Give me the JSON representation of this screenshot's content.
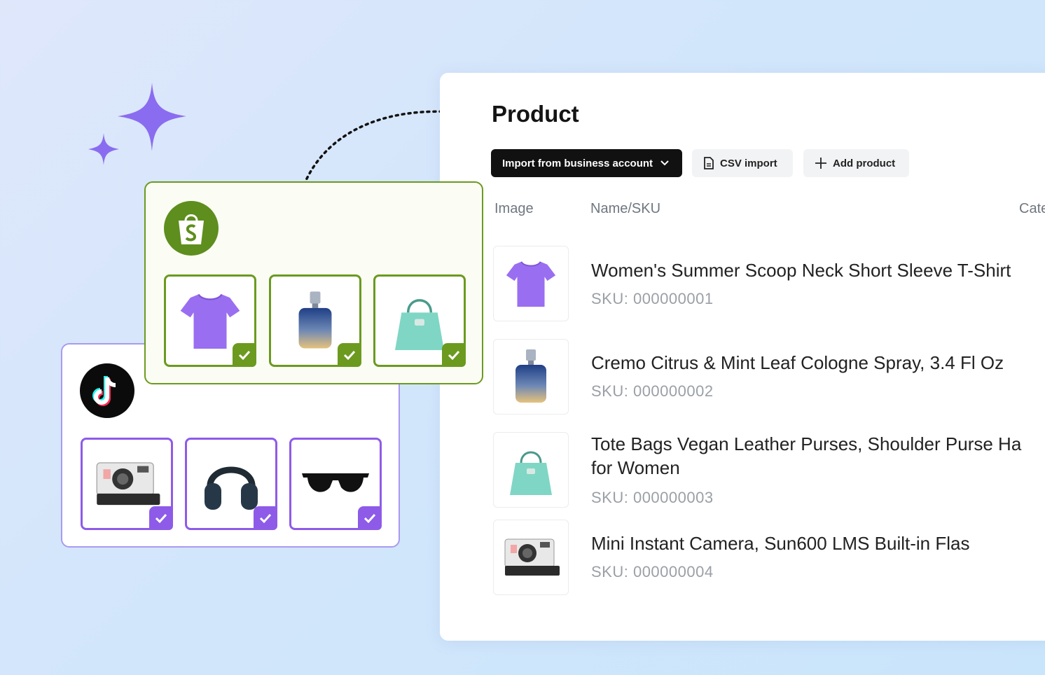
{
  "panel": {
    "title": "Product",
    "import_button": "Import from business account",
    "csv_button": "CSV import",
    "add_button": "Add product",
    "columns": [
      "Image",
      "Name/SKU",
      "Cate"
    ]
  },
  "products": [
    {
      "name": "Women's Summer Scoop Neck Short Sleeve T-Shirt",
      "sku": "SKU: 000000001",
      "image": "purple-tshirt"
    },
    {
      "name": "Cremo Citrus & Mint Leaf Cologne Spray, 3.4 Fl Oz",
      "sku": "SKU: 000000002",
      "image": "cologne-bottle"
    },
    {
      "name_line1": "Tote Bags Vegan Leather Purses, Shoulder Purse Ha",
      "name_line2": "for Women",
      "sku": "SKU: 000000003",
      "image": "teal-handbag"
    },
    {
      "name": "Mini Instant Camera, Sun600 LMS Built-in Flas",
      "sku": "SKU: 000000004",
      "image": "instant-camera"
    }
  ],
  "shopify_card": {
    "logo": "shopify-icon",
    "items": [
      "purple-tshirt",
      "cologne-bottle",
      "teal-handbag"
    ]
  },
  "tiktok_card": {
    "logo": "tiktok-icon",
    "items": [
      "instant-camera",
      "headphones",
      "sunglasses"
    ]
  },
  "colors": {
    "shopify": "#6b9a1f",
    "tiktok_accent": "#8e5be8",
    "sparkle": "#8a6cf0",
    "dark_button": "#111111"
  }
}
